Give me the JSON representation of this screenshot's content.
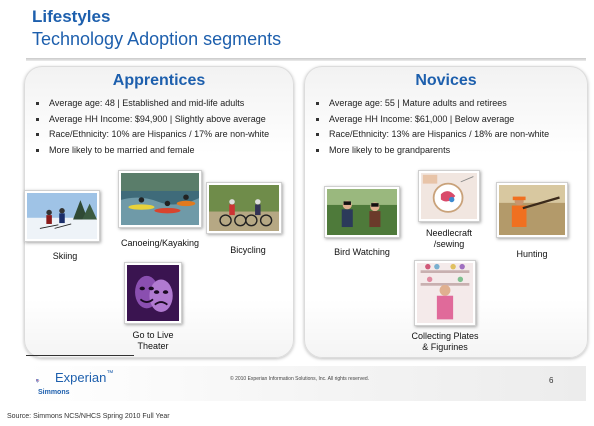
{
  "header": {
    "title": "Lifestyles",
    "subtitle": "Technology Adoption segments"
  },
  "apprentices": {
    "title": "Apprentices",
    "bullets": [
      "Average age: 48 | Established and mid-life adults",
      "Average HH Income: $94,900 | Slightly above average",
      "Race/Ethnicity: 10% are Hispanics / 17% are non-white",
      "More likely to be married and female"
    ],
    "activities": {
      "skiing": "Skiing",
      "kayaking": "Canoeing/Kayaking",
      "bicycling": "Bicycling",
      "theater_line1": "Go to Live",
      "theater_line2": "Theater"
    }
  },
  "novices": {
    "title": "Novices",
    "bullets": [
      "Average age: 55 | Mature adults and retirees",
      "Average HH Income: $61,000 | Below average",
      "Race/Ethnicity: 13% are Hispanics / 18% are non-white",
      "More likely to be grandparents"
    ],
    "activities": {
      "birdwatching": "Bird Watching",
      "needlecraft_line1": "Needlecraft",
      "needlecraft_line2": "/sewing",
      "hunting": "Hunting",
      "collecting_line1": "Collecting Plates",
      "collecting_line2": "& Figurines"
    }
  },
  "footer": {
    "brand": "Experian",
    "brand_tm": "™",
    "brand_sub": "Simmons",
    "copyright": "© 2010 Experian Information Solutions, Inc.  All rights reserved.",
    "page_number": "6",
    "source": "Source:  Simmons NCS/NHCS Spring 2010 Full Year"
  },
  "colors": {
    "accent": "#1d5fad",
    "logo_purple": "#7b2c82",
    "logo_blue": "#1d5fad"
  }
}
